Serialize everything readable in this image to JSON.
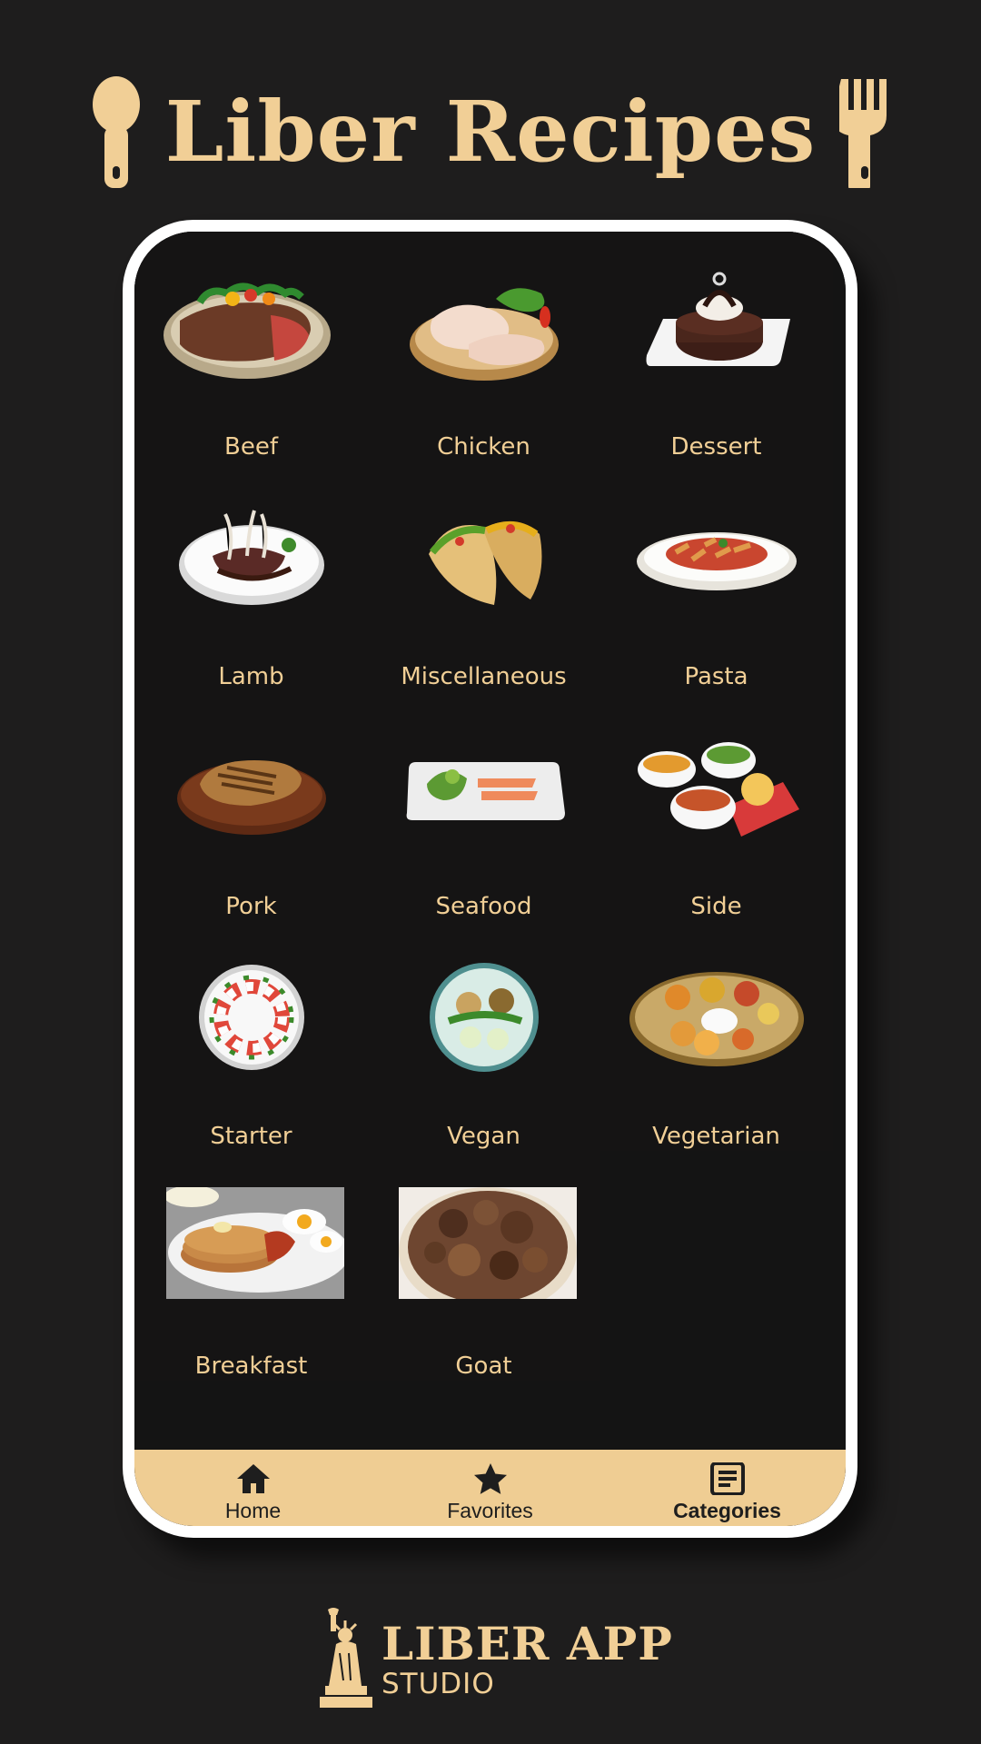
{
  "app": {
    "title": "Liber Recipes"
  },
  "categories": [
    {
      "label": "Beef",
      "icon": "beef-steak-plate"
    },
    {
      "label": "Chicken",
      "icon": "chicken-legs-board"
    },
    {
      "label": "Dessert",
      "icon": "chocolate-cake-plate"
    },
    {
      "label": "Lamb",
      "icon": "lamb-chops-plate"
    },
    {
      "label": "Miscellaneous",
      "icon": "tacos"
    },
    {
      "label": "Pasta",
      "icon": "penne-pasta-plate"
    },
    {
      "label": "Pork",
      "icon": "pork-chop-board"
    },
    {
      "label": "Seafood",
      "icon": "salmon-plate"
    },
    {
      "label": "Side",
      "icon": "side-bowls"
    },
    {
      "label": "Starter",
      "icon": "caprese-plate"
    },
    {
      "label": "Vegan",
      "icon": "vegan-bowl"
    },
    {
      "label": "Vegetarian",
      "icon": "thali-platter"
    },
    {
      "label": "Breakfast",
      "icon": "pancakes-eggs-photo"
    },
    {
      "label": "Goat",
      "icon": "goat-stew-photo"
    }
  ],
  "nav": {
    "items": [
      {
        "label": "Home",
        "icon": "home-icon",
        "active": false
      },
      {
        "label": "Favorites",
        "icon": "star-icon",
        "active": false
      },
      {
        "label": "Categories",
        "icon": "article-icon",
        "active": true
      }
    ]
  },
  "brand": {
    "main": "LIBER APP",
    "sub": "STUDIO"
  },
  "colors": {
    "background": "#1e1d1d",
    "accent": "#f1cf96",
    "nav_bar": "#efcd93",
    "frame": "#ffffff"
  }
}
